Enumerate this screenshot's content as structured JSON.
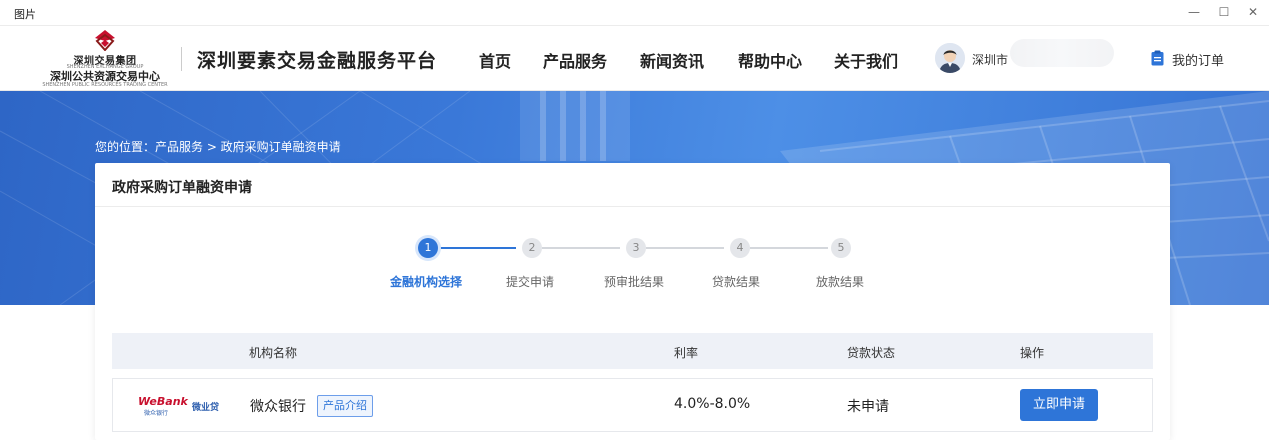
{
  "window": {
    "title": "图片",
    "controls": {
      "minimize": "—",
      "maximize": "☐",
      "close": "✕"
    }
  },
  "header": {
    "logo": {
      "group_name": "深圳交易集团",
      "group_sub": "SHENZHEN EXCHANGE GROUP",
      "center_name": "深圳公共资源交易中心",
      "center_sub": "SHENZHEN PUBLIC RESOURCES TRADING CENTER"
    },
    "platform_title": "深圳要素交易金融服务平台",
    "nav": [
      "首页",
      "产品服务",
      "新闻资讯",
      "帮助中心",
      "关于我们"
    ],
    "user_name": "深圳市",
    "my_orders": "我的订单"
  },
  "breadcrumb": "您的位置：产品服务 > 政府采购订单融资申请",
  "card": {
    "title": "政府采购订单融资申请",
    "steps": [
      {
        "num": "1",
        "label": "金融机构选择",
        "active": true
      },
      {
        "num": "2",
        "label": "提交申请",
        "active": false
      },
      {
        "num": "3",
        "label": "预审批结果",
        "active": false
      },
      {
        "num": "4",
        "label": "贷款结果",
        "active": false
      },
      {
        "num": "5",
        "label": "放款结果",
        "active": false
      }
    ],
    "table": {
      "headers": [
        "机构名称",
        "利率",
        "贷款状态",
        "操作"
      ],
      "rows": [
        {
          "logo_text": "WeBank",
          "logo_sub": "微众银行",
          "logo_product": "微业贷",
          "name": "微众银行",
          "intro_tag": "产品介绍",
          "rate": "4.0%-8.0%",
          "status": "未申请",
          "action": "立即申请"
        }
      ]
    }
  },
  "colors": {
    "accent": "#2e75d8",
    "banner": "#3a78d8",
    "table_header_bg": "#eef1f7",
    "logo_red": "#c8102e"
  }
}
